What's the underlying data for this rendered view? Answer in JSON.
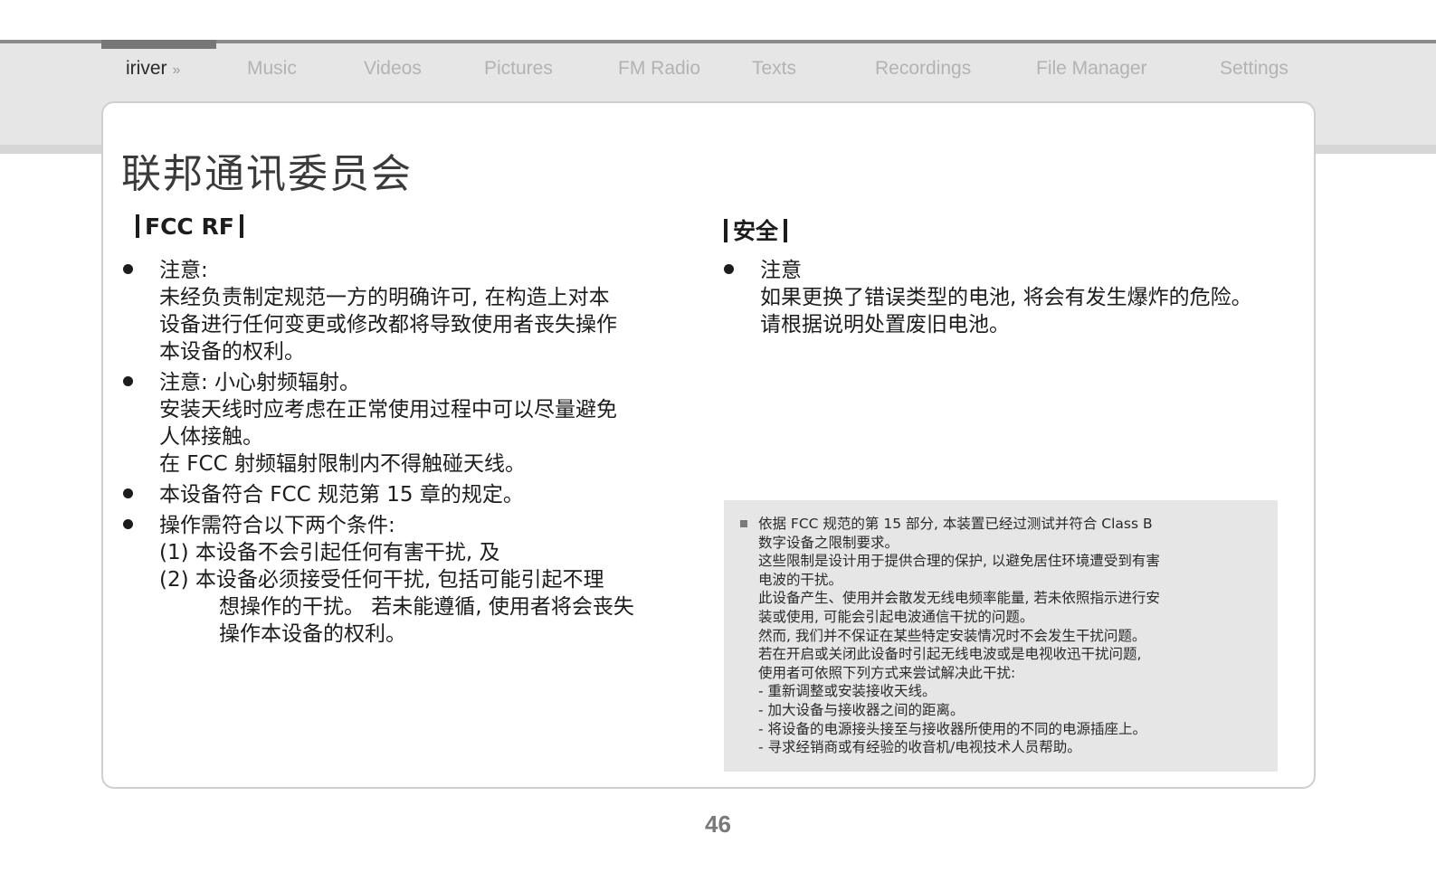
{
  "nav": {
    "brand": "iriver",
    "brand_arrow": "»",
    "tabs": [
      "Music",
      "Videos",
      "Pictures",
      "FM Radio",
      "Texts",
      "Recordings",
      "File Manager",
      "Settings"
    ]
  },
  "page": {
    "title": "联邦通讯委员会",
    "number": "46"
  },
  "left_section": {
    "heading": "FCC RF",
    "items": [
      {
        "lines": [
          "注意:",
          "未经负责制定规范一方的明确许可, 在构造上对本",
          "设备进行任何变更或修改都将导致使用者丧失操作",
          "本设备的权利。"
        ]
      },
      {
        "lines": [
          "注意: 小心射频辐射。",
          "安装天线时应考虑在正常使用过程中可以尽量避免",
          "人体接触。",
          "在 FCC 射频辐射限制内不得触碰天线。"
        ]
      },
      {
        "lines": [
          "本设备符合 FCC 规范第 15 章的规定。"
        ]
      },
      {
        "lines": [
          "操作需符合以下两个条件:",
          "(1) 本设备不会引起任何有害干扰, 及",
          "(2) 本设备必须接受任何干扰, 包括可能引起不理",
          "想操作的干扰。 若未能遵循, 使用者将会丧失",
          "操作本设备的权利。"
        ]
      }
    ]
  },
  "right_section": {
    "heading": "安全",
    "items": [
      {
        "lines": [
          "注意",
          "如果更换了错误类型的电池, 将会有发生爆炸的危险。",
          "请根据说明处置废旧电池。"
        ]
      }
    ]
  },
  "note": {
    "lines": [
      "依据 FCC 规范的第 15 部分, 本装置已经过测试并符合 Class B",
      "数字设备之限制要求。",
      "这些限制是设计用于提供合理的保护, 以避免居住环境遭受到有害",
      "电波的干扰。",
      "此设备产生、使用并会散发无线电频率能量, 若未依照指示进行安",
      "装或使用, 可能会引起电波通信干扰的问题。",
      "然而, 我们并不保证在某些特定安装情况时不会发生干扰问题。",
      "若在开启或关闭此设备时引起无线电波或是电视收迅干扰问题,",
      "使用者可依照下列方式来尝试解决此干扰:",
      "- 重新调整或安装接收天线。",
      "- 加大设备与接收器之间的距离。",
      "- 将设备的电源接头接至与接收器所使用的不同的电源插座上。",
      "- 寻求经销商或有经验的收音机/电视技术人员帮助。"
    ]
  }
}
